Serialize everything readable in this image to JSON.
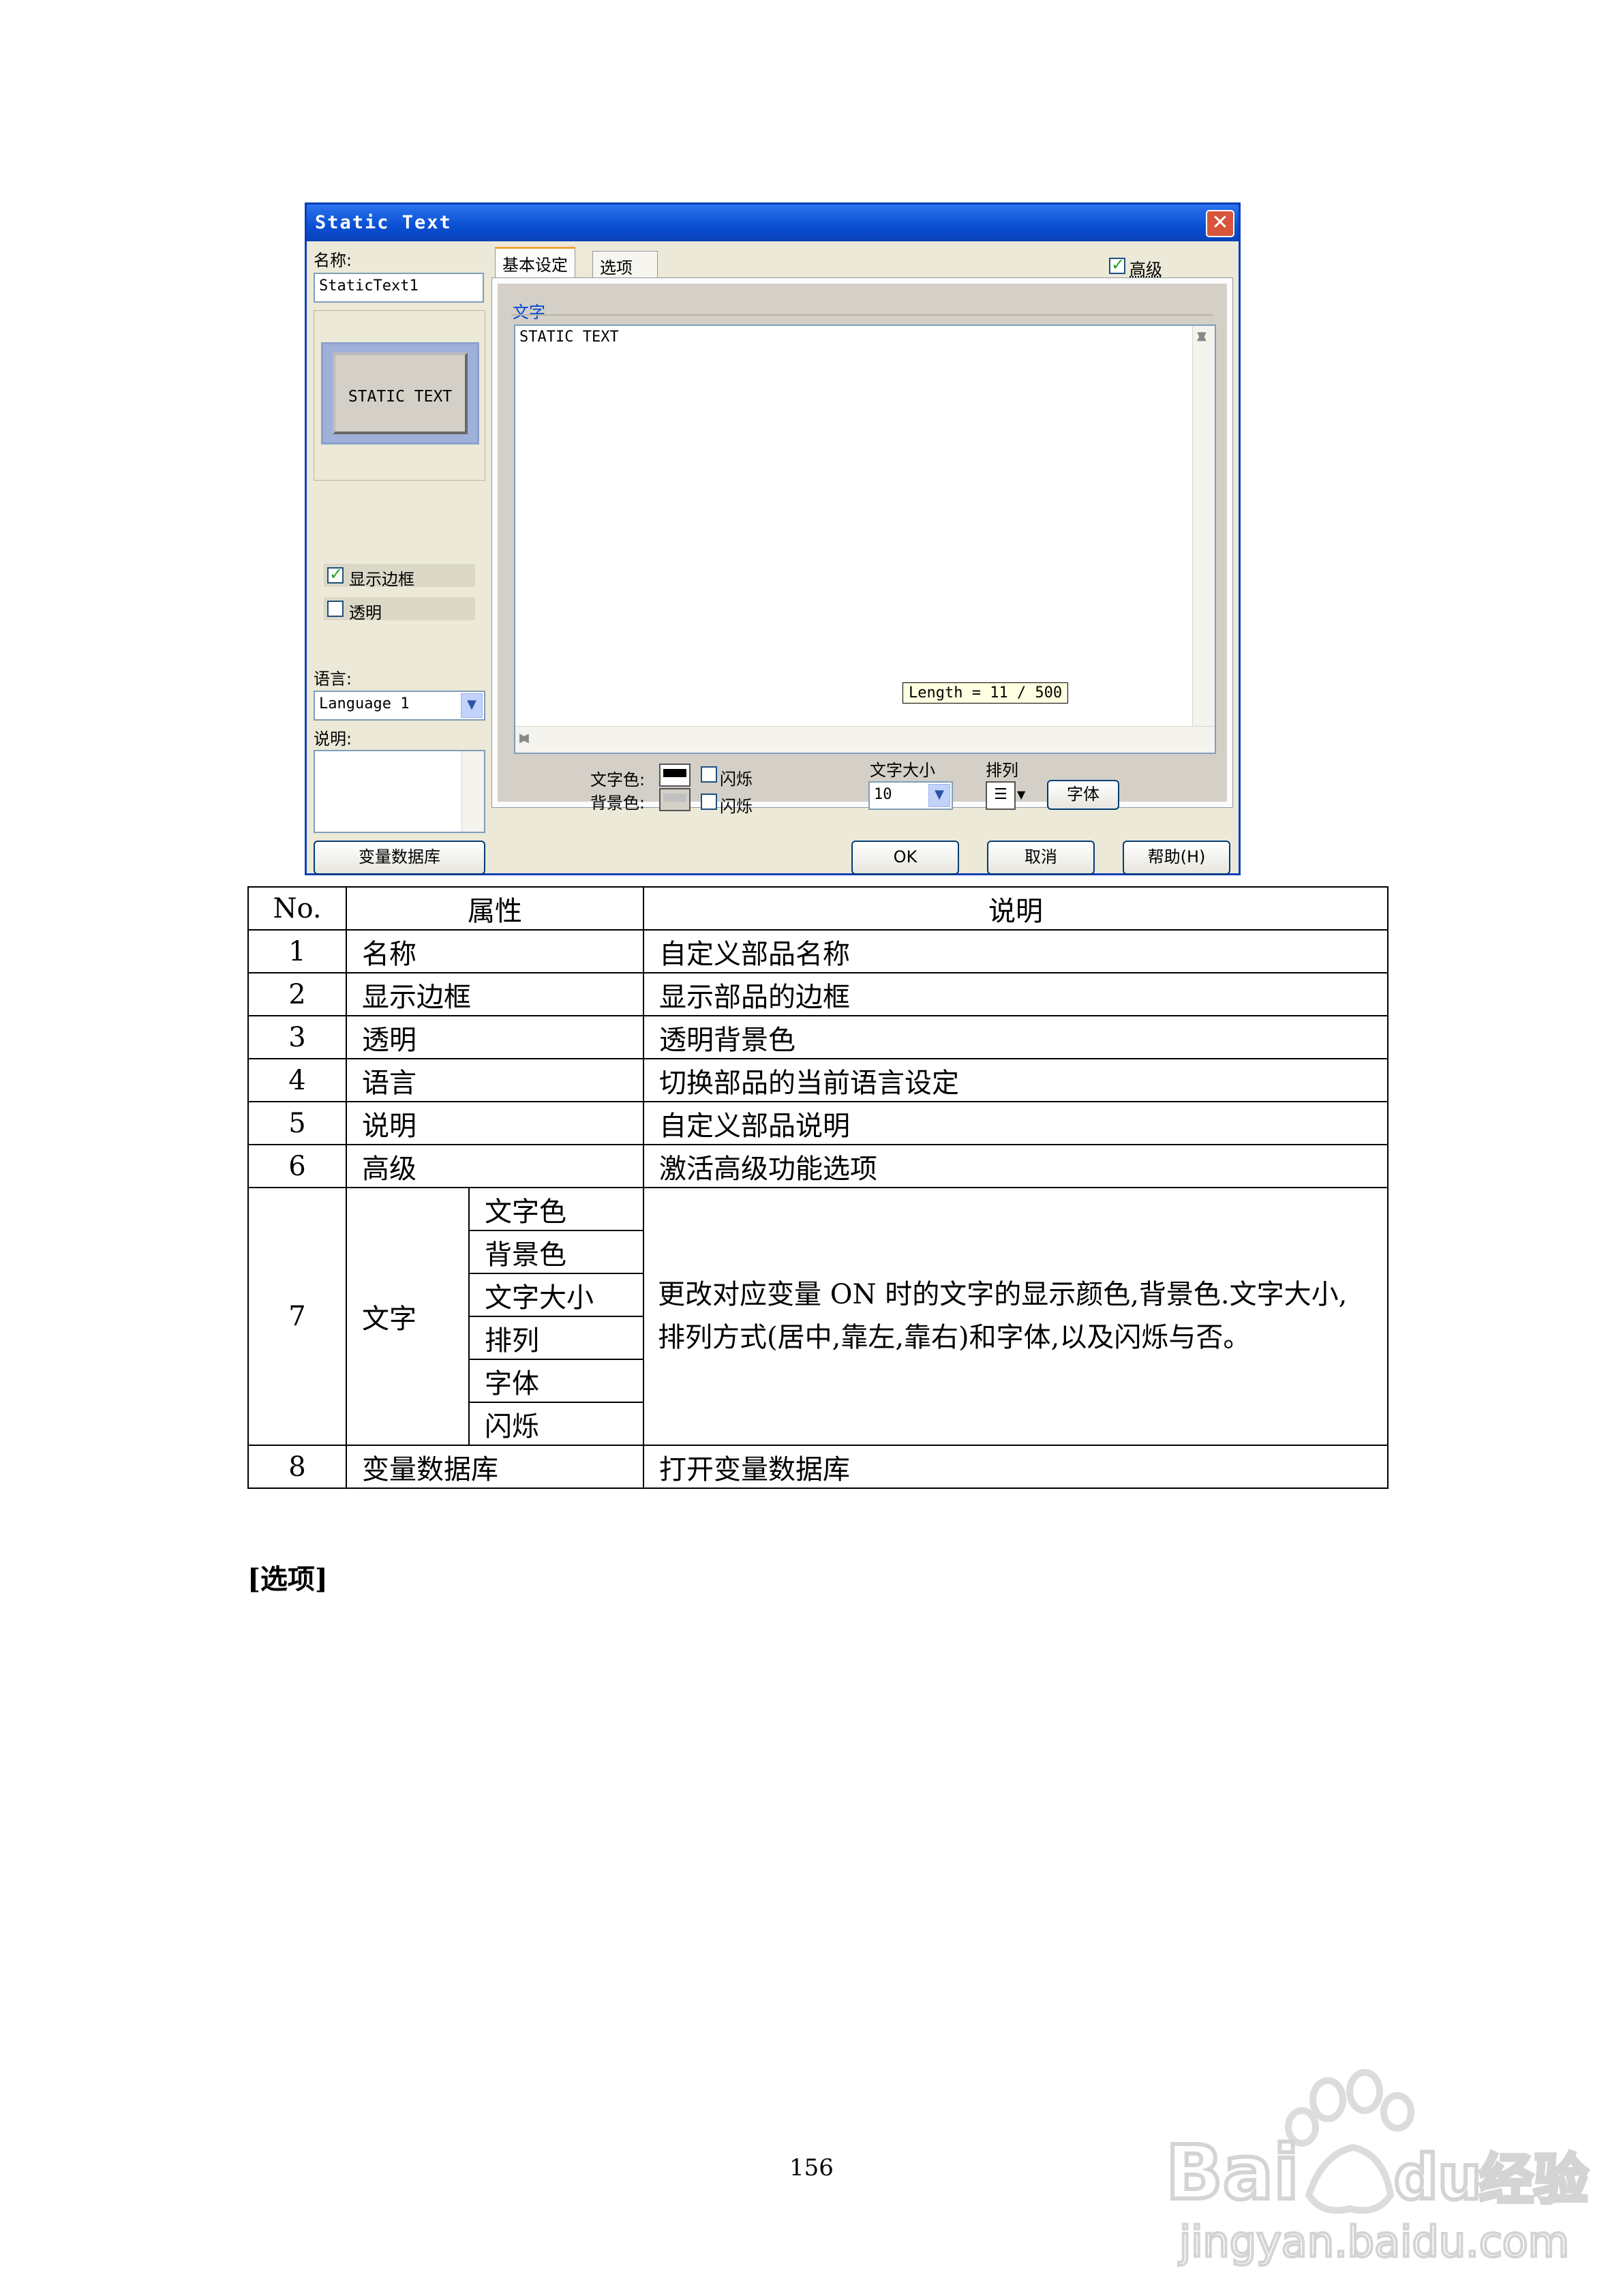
{
  "dialog": {
    "title": "Static Text",
    "name_label": "名称:",
    "name_value": "StaticText1",
    "preview_text": "STATIC TEXT",
    "show_border_label": "显示边框",
    "transparent_label": "透明",
    "language_label": "语言:",
    "language_value": "Language 1",
    "description_label": "说明:",
    "var_db_button": "变量数据库",
    "tabs": [
      "基本设定",
      "选项"
    ],
    "advanced_label": "高级",
    "text_group_title": "文字",
    "text_content": "STATIC TEXT",
    "length_tooltip": "Length = 11 / 500",
    "text_color_label": "文字色:",
    "bg_color_label": "背景色:",
    "blink_label_1": "闪烁",
    "blink_label_2": "闪烁",
    "font_size_label": "文字大小",
    "font_size_value": "10",
    "align_label": "排列",
    "font_button": "字体",
    "ok_button": "OK",
    "cancel_button": "取消",
    "help_button": "帮助(H)"
  },
  "table": {
    "headers": [
      "No.",
      "属性",
      "说明"
    ],
    "rows": [
      {
        "no": "1",
        "prop": "名称",
        "desc": "自定义部品名称"
      },
      {
        "no": "2",
        "prop": "显示边框",
        "desc": "显示部品的边框"
      },
      {
        "no": "3",
        "prop": "透明",
        "desc": "透明背景色"
      },
      {
        "no": "4",
        "prop": "语言",
        "desc": "切换部品的当前语言设定"
      },
      {
        "no": "5",
        "prop": "说明",
        "desc": "自定义部品说明"
      },
      {
        "no": "6",
        "prop": "高级",
        "desc": "激活高级功能选项"
      }
    ],
    "row7": {
      "no": "7",
      "prop": "文字",
      "sub": [
        "文字色",
        "背景色",
        "文字大小",
        "排列",
        "字体",
        "闪烁"
      ],
      "desc_line1": "更改对应变量 ON 时的文字的显示颜色,背景色.文字大小,",
      "desc_line2": "排列方式(居中,靠左,靠右)和字体,以及闪烁与否。"
    },
    "row8": {
      "no": "8",
      "prop": "变量数据库",
      "desc": "打开变量数据库"
    }
  },
  "section_heading": "[选项]",
  "page_number": "156",
  "watermark": {
    "line1": "Bai du 经验",
    "line2": "jingyan.baidu.com"
  }
}
